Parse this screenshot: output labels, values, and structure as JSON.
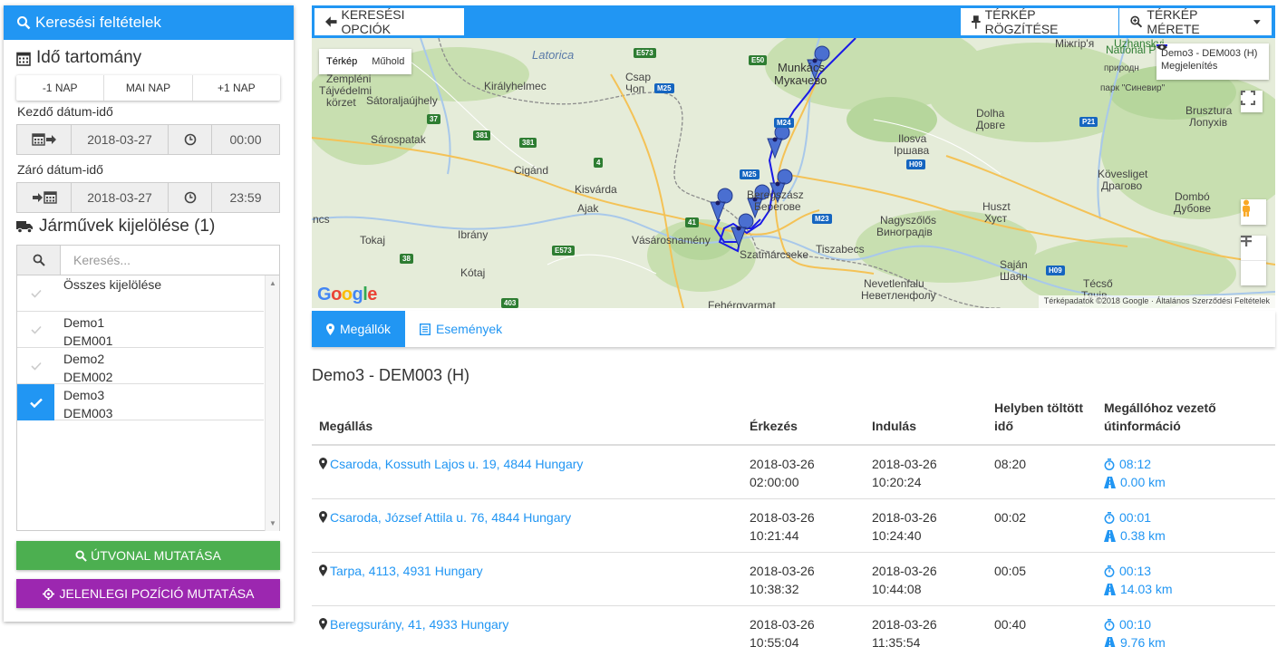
{
  "left_panel": {
    "header": "Keresési feltételek",
    "time_range_title": "Idő tartomány",
    "day_buttons": [
      "-1 NAP",
      "MAI NAP",
      "+1 NAP"
    ],
    "start_label": "Kezdő dátum-idő",
    "start_date": "2018-03-27",
    "start_time": "00:00",
    "end_label": "Záró dátum-idő",
    "end_date": "2018-03-27",
    "end_time": "23:59",
    "vehicles_title": "Járművek kijelölése (1)",
    "search_placeholder": "Keresés...",
    "select_all": "Összes kijelölése",
    "vehicles": [
      {
        "name": "Demo1",
        "code": "DEM001",
        "checked": false
      },
      {
        "name": "Demo2",
        "code": "DEM002",
        "checked": false
      },
      {
        "name": "Demo3",
        "code": "DEM003",
        "checked": true
      }
    ],
    "route_button": "ÚTVONAL MUTATÁSA",
    "position_button": "JELENLEGI POZÍCIÓ MUTATÁSA"
  },
  "topbar": {
    "search_options": "KERESÉSI OPCIÓK",
    "pin_map": "TÉRKÉP RÖGZÍTÉSE",
    "map_size": "TÉRKÉP MÉRETE"
  },
  "map": {
    "type_map": "Térkép",
    "type_satellite": "Műhold",
    "legend_series": "Demo3 - DEM003 (H)",
    "legend_toggle": "Megjelenítés",
    "attribution": "Térképadatok ©2018 Google · Általános Szerződési Feltételek",
    "labels": {
      "latorica": "Latorica",
      "zemplen1": "Zempléni",
      "zemplen2": "Tájvédelmi",
      "zemplen3": "körzet",
      "kiralyhelmec": "Királyhelmec",
      "csap1": "Csap",
      "csap2": "Чоп",
      "satoralja": "Sátoraljaújhely",
      "sarospatak": "Sárospatak",
      "cigand": "Cigánd",
      "kisvarda": "Kisvárda",
      "ajak": "Ajak",
      "tokaj": "Tokaj",
      "ibrany": "Ibrány",
      "kotaj": "Kótaj",
      "vasarosnameny": "Vásárosnamény",
      "ncs": "ncs",
      "munkacs1": "Munkács",
      "munkacs2": "Мукачево",
      "beregszasz1": "Beregszász",
      "beregszasz2": "Берегове",
      "ilosva1": "Ilosva",
      "ilosva2": "Іршава",
      "dolha1": "Dolha",
      "dolha2": "Довге",
      "koveslige1": "Kövesliget",
      "koveslige2": "Драгово",
      "nagyszolos1": "Nagyszőlős",
      "nagyszolos2": "Виноградів",
      "tiszabecs": "Tiszabecs",
      "szatmarcseke": "Szatmárcseke",
      "huszt1": "Huszt",
      "huszt2": "Хуст",
      "dombo1": "Dombó",
      "dombo2": "Дубове",
      "brusztura1": "Brusztura",
      "brusztura2": "Лопухів",
      "szajan1": "Saján",
      "szajan2": "Шаян",
      "tecso1": "Técső",
      "tecso2": "Тячів",
      "nevetlen1": "Nevetlenfalu",
      "nevetlen2": "Неветленфолу",
      "mizhhirya": "Міжгір'я",
      "np1": "Uzhanskyi",
      "np2": "National Park",
      "np3": "природн",
      "np4": "парк \"Синевир\"",
      "fehergyarmat": "Fehérgyarmat",
      "google": "Google"
    },
    "roads": [
      "E573",
      "M25",
      "E50",
      "37",
      "381",
      "381",
      "4",
      "M25",
      "41",
      "E573",
      "38",
      "403",
      "M23",
      "H09",
      "P21",
      "H09",
      "M24"
    ]
  },
  "tabs": {
    "stops": "Megállók",
    "events": "Események"
  },
  "content": {
    "vehicle_title": "Demo3 - DEM003 (H)",
    "columns": {
      "stop": "Megállás",
      "arrival": "Érkezés",
      "departure": "Indulás",
      "time_spent_1": "Helyben töltött",
      "time_spent_2": "idő",
      "route_info_1": "Megállóhoz vezető",
      "route_info_2": "útinformáció"
    },
    "rows": [
      {
        "address": "Csaroda, Kossuth Lajos u. 19, 4844 Hungary",
        "arr_date": "2018-03-26",
        "arr_time": "02:00:00",
        "dep_date": "2018-03-26",
        "dep_time": "10:20:24",
        "spent": "08:20",
        "drive_time": "08:12",
        "distance": "0.00 km"
      },
      {
        "address": "Csaroda, József Attila u. 76, 4844 Hungary",
        "arr_date": "2018-03-26",
        "arr_time": "10:21:44",
        "dep_date": "2018-03-26",
        "dep_time": "10:24:40",
        "spent": "00:02",
        "drive_time": "00:01",
        "distance": "0.38 km"
      },
      {
        "address": "Tarpa, 4113, 4931 Hungary",
        "arr_date": "2018-03-26",
        "arr_time": "10:38:32",
        "dep_date": "2018-03-26",
        "dep_time": "10:44:08",
        "spent": "00:05",
        "drive_time": "00:13",
        "distance": "14.03 km"
      },
      {
        "address": "Beregsurány, 41, 4933 Hungary",
        "arr_date": "2018-03-26",
        "arr_time": "10:55:04",
        "dep_date": "2018-03-26",
        "dep_time": "11:35:54",
        "spent": "00:40",
        "drive_time": "00:10",
        "distance": "9.76 km"
      }
    ]
  },
  "colors": {
    "primary": "#2196f3",
    "green": "#4caf50",
    "purple": "#9c27b0",
    "route": "#1a1ae6"
  }
}
